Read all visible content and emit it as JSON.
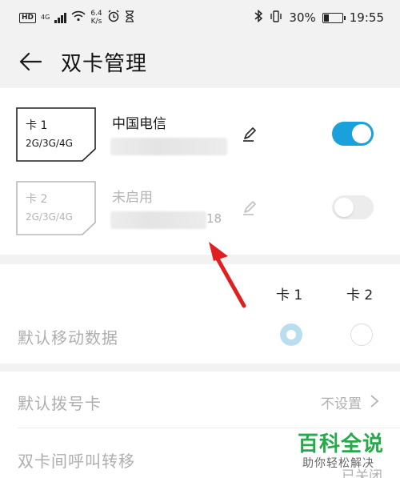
{
  "status_bar": {
    "hd": "HD",
    "network_type": "4G",
    "speed_value": "6.4",
    "speed_unit": "K/s",
    "battery": "30%",
    "battery_level": 0.3,
    "time": "19:55"
  },
  "header": {
    "title": "双卡管理"
  },
  "sim_cards": [
    {
      "name": "卡 1",
      "network": "2G/3G/4G",
      "carrier": "中国电信",
      "number_suffix": "",
      "enabled": true
    },
    {
      "name": "卡 2",
      "network": "2G/3G/4G",
      "carrier": "未启用",
      "number_suffix": "18",
      "enabled": false
    }
  ],
  "default_data": {
    "col1": "卡 1",
    "col2": "卡 2",
    "label": "默认移动数据",
    "selected": "卡 1"
  },
  "list": [
    {
      "label": "默认拨号卡",
      "value": "不设置"
    },
    {
      "label": "双卡间呼叫转移",
      "value": "已关闭"
    }
  ],
  "watermark": {
    "title": "百科全说",
    "subtitle": "助你轻松解决"
  },
  "colors": {
    "accent": "#1aa1dc",
    "watermark_green": "#27a84b",
    "arrow_red": "#e02020"
  }
}
